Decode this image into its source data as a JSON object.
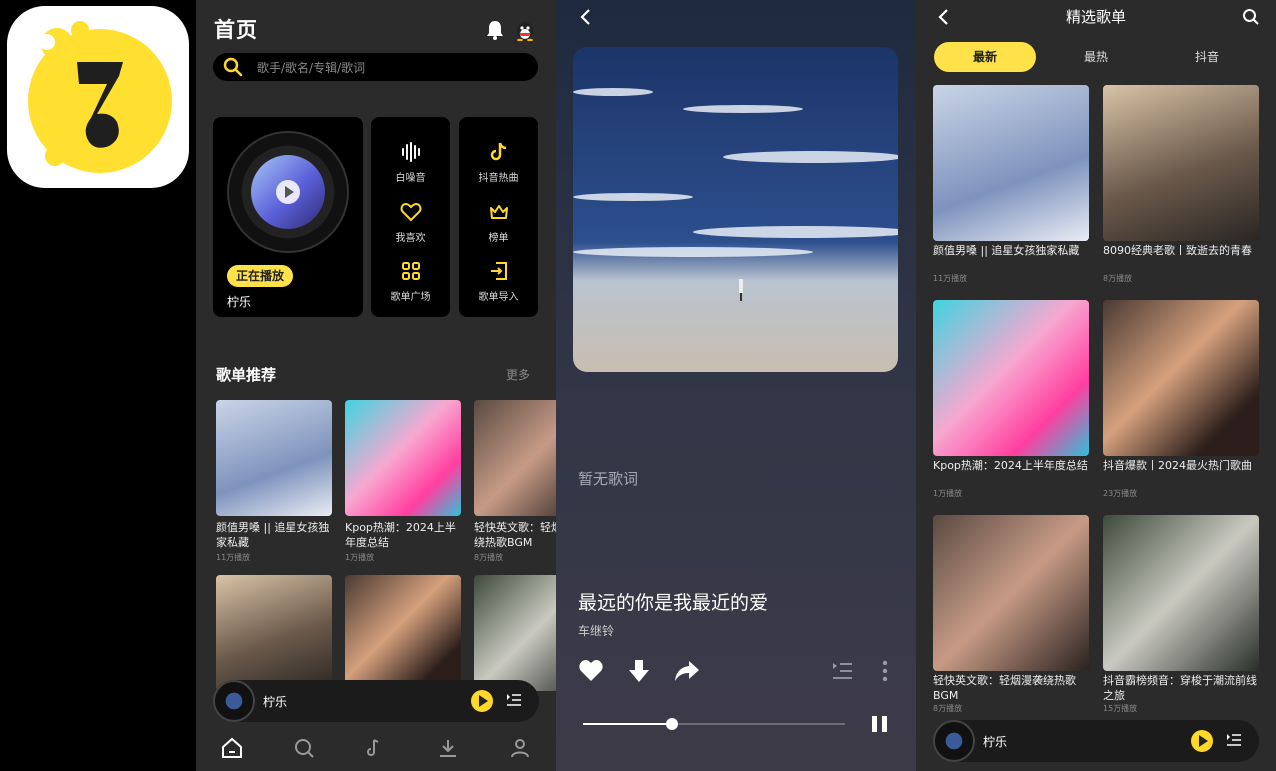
{
  "colors": {
    "accent": "#ffe24a",
    "panel_bg": "#2b2b2b",
    "card_bg": "#000000"
  },
  "home": {
    "title": "首页",
    "search_placeholder": "歌手/歌名/专辑/歌词",
    "now_playing_badge": "正在播放",
    "now_playing_song": "柠乐",
    "quick": [
      {
        "label": "白噪音",
        "icon": "waveform-icon"
      },
      {
        "label": "抖音热曲",
        "icon": "tiktok-icon"
      },
      {
        "label": "我喜欢",
        "icon": "heart-icon"
      },
      {
        "label": "榜单",
        "icon": "crown-icon"
      },
      {
        "label": "歌单广场",
        "icon": "grid-icon"
      },
      {
        "label": "歌单导入",
        "icon": "import-icon"
      }
    ],
    "section_title": "歌单推荐",
    "section_more": "更多",
    "playlists": [
      {
        "title": "颜值男嗓 || 追星女孩独家私藏",
        "count": "11万播放"
      },
      {
        "title": "Kpop热潮：2024上半年度总结",
        "count": "1万播放"
      },
      {
        "title": "轻快英文歌：轻烟漫袭绕热歌BGM",
        "count": "8万播放"
      }
    ],
    "mini_player": {
      "song": "柠乐"
    }
  },
  "player": {
    "lyric": "暂无歌词",
    "song": "最远的你是我最近的爱",
    "artist": "车继铃",
    "progress": 0.34
  },
  "lists": {
    "title": "精选歌单",
    "tabs": [
      "最新",
      "最热",
      "抖音"
    ],
    "items": [
      {
        "title": "颜值男嗓 || 追星女孩独家私藏",
        "count": "11万播放"
      },
      {
        "title": "8090经典老歌丨致逝去的青春",
        "count": "8万播放"
      },
      {
        "title": "Kpop热潮：2024上半年度总结",
        "count": "1万播放"
      },
      {
        "title": "抖音爆款丨2024最火热门歌曲",
        "count": "23万播放"
      },
      {
        "title": "轻快英文歌：轻烟漫袭绕热歌BGM",
        "count": "8万播放"
      },
      {
        "title": "抖音霸榜频音：穿梭于潮流前线之旅",
        "count": "15万播放"
      }
    ],
    "mini_player": {
      "song": "柠乐"
    }
  }
}
